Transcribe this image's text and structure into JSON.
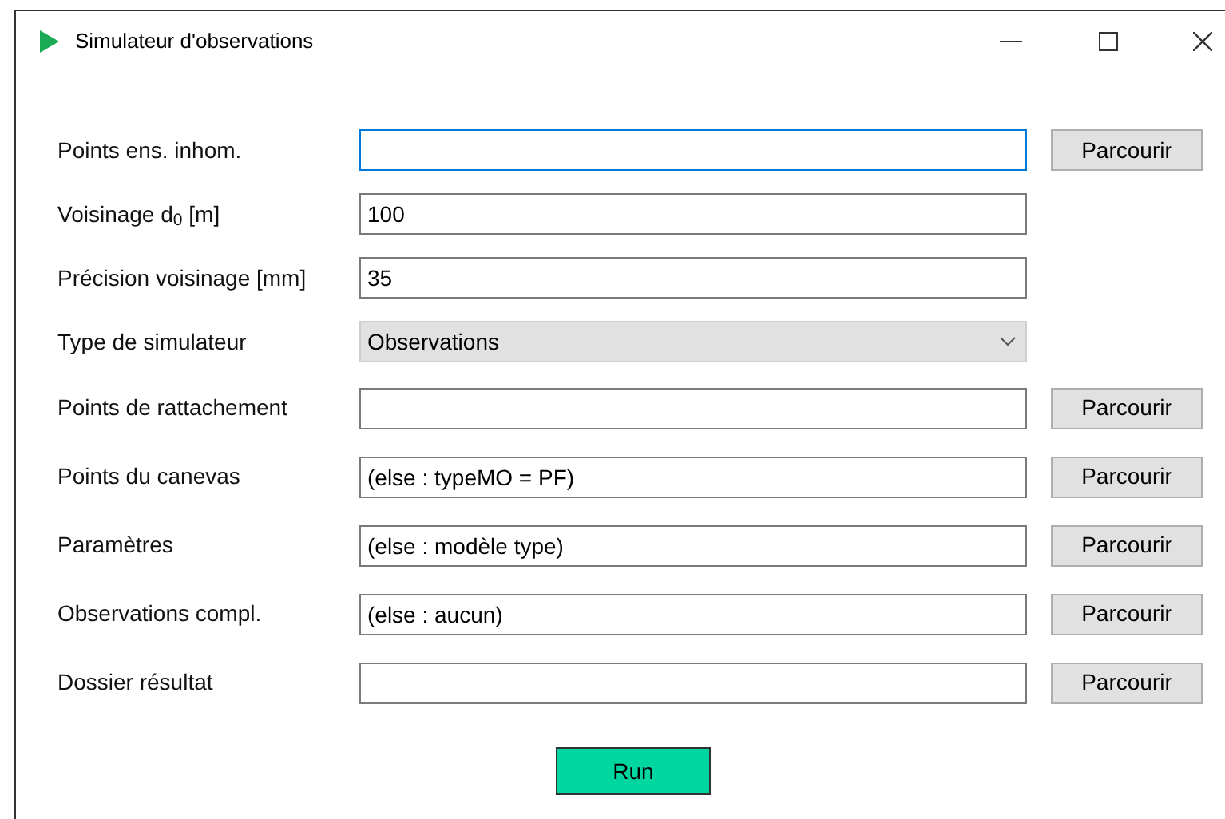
{
  "window": {
    "title": "Simulateur d'observations"
  },
  "rows": [
    {
      "kind": "text",
      "label": "Points ens. inhom.",
      "value": "",
      "focused": true,
      "browse": "Parcourir"
    },
    {
      "kind": "text",
      "label": "Voisinage d$_{0}$ [m]",
      "value": "100",
      "focused": false
    },
    {
      "kind": "text",
      "label": "Précision voisinage [mm]",
      "value": "35",
      "focused": false
    },
    {
      "kind": "select",
      "label": "Type de simulateur",
      "value": "Observations"
    },
    {
      "kind": "text",
      "label": "Points de rattachement",
      "value": "",
      "focused": false,
      "browse": "Parcourir"
    },
    {
      "kind": "text",
      "label": "Points du canevas",
      "value": "(else : typeMO = PF)",
      "focused": false,
      "browse": "Parcourir"
    },
    {
      "kind": "text",
      "label": "Paramètres",
      "value": "(else : modèle type)",
      "focused": false,
      "browse": "Parcourir"
    },
    {
      "kind": "text",
      "label": "Observations compl.",
      "value": "(else : aucun)",
      "focused": false,
      "browse": "Parcourir"
    },
    {
      "kind": "text",
      "label": "Dossier résultat",
      "value": "",
      "focused": false,
      "browse": "Parcourir"
    }
  ],
  "run_button": "Run"
}
